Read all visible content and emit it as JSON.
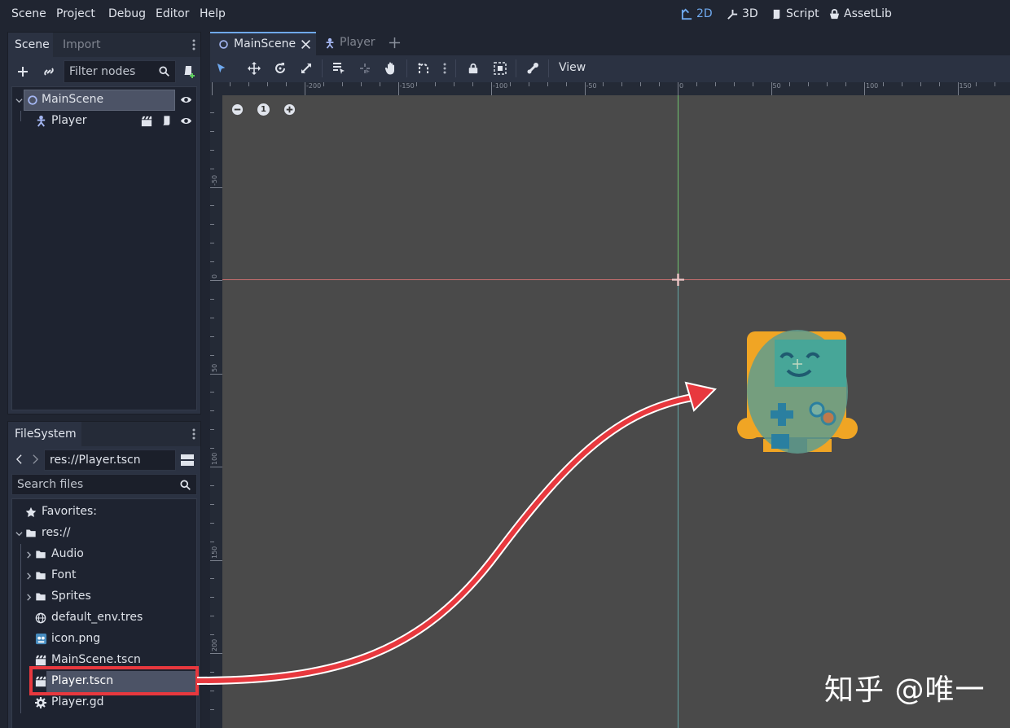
{
  "menubar": {
    "items": [
      "Scene",
      "Project",
      "Debug",
      "Editor",
      "Help"
    ],
    "workspaces": {
      "2d": "2D",
      "3d": "3D",
      "script": "Script",
      "assetlib": "AssetLib"
    }
  },
  "scene_dock": {
    "tabs": {
      "scene": "Scene",
      "import": "Import"
    },
    "filter_placeholder": "Filter nodes",
    "nodes": [
      {
        "label": "MainScene",
        "icon": "node2d-circle-icon"
      },
      {
        "label": "Player",
        "icon": "kinematic-body-icon"
      }
    ]
  },
  "filesystem_dock": {
    "tab": "FileSystem",
    "path": "res://Player.tscn",
    "search_placeholder": "Search files",
    "favorites": "Favorites:",
    "root": "res://",
    "items": [
      {
        "label": "Audio",
        "type": "folder"
      },
      {
        "label": "Font",
        "type": "folder"
      },
      {
        "label": "Sprites",
        "type": "folder"
      },
      {
        "label": "default_env.tres",
        "type": "globe"
      },
      {
        "label": "icon.png",
        "type": "image"
      },
      {
        "label": "MainScene.tscn",
        "type": "scene"
      },
      {
        "label": "Player.tscn",
        "type": "scene"
      },
      {
        "label": "Player.gd",
        "type": "gear"
      }
    ]
  },
  "editor": {
    "tabs": {
      "main": "MainScene",
      "player": "Player"
    },
    "view_menu": "View"
  },
  "rulers": {
    "h_labels": [
      "-200",
      "-150",
      "-100",
      "-50",
      "0",
      "50",
      "100",
      "150"
    ],
    "v_labels": [
      "-50",
      "0",
      "50",
      "100",
      "150",
      "200"
    ]
  },
  "zoom": {
    "reset": "1"
  },
  "watermark": "知乎 @唯一",
  "colors": {
    "accent": "#6fa9ef",
    "annotation": "#e8383e"
  }
}
